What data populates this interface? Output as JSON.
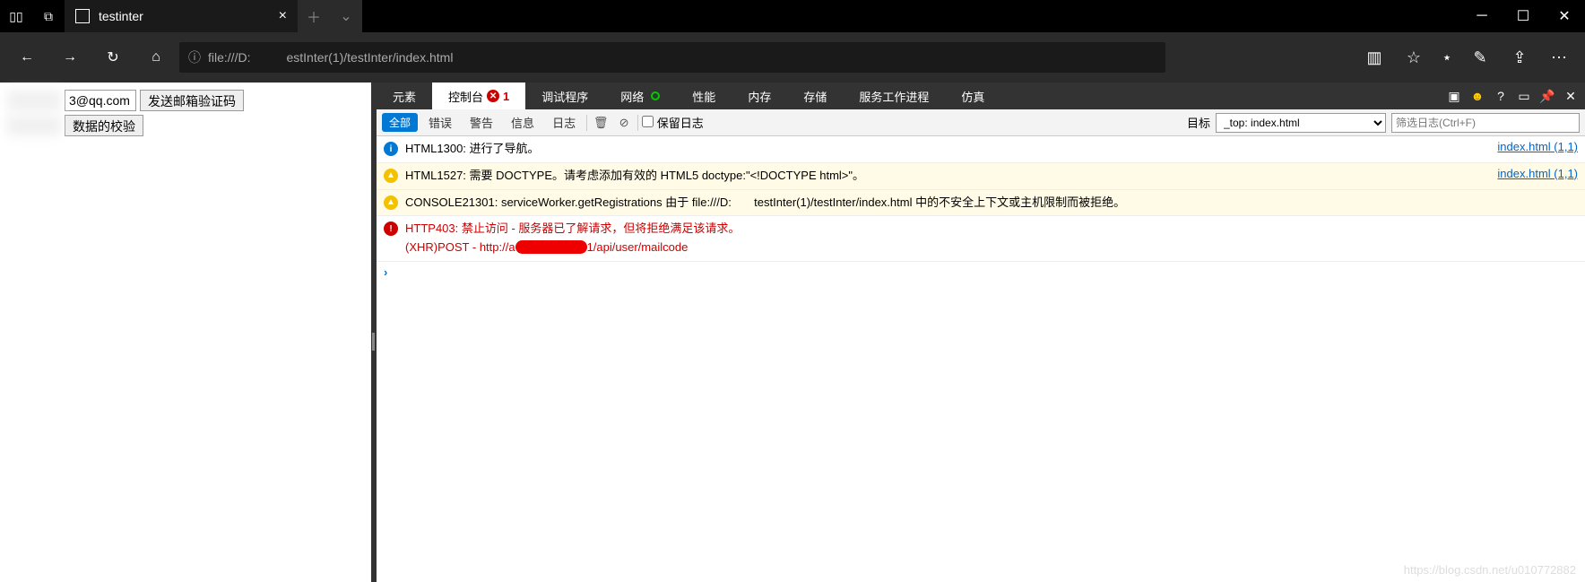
{
  "window": {
    "tab_title": "testinter",
    "url_left": "file:///D:",
    "url_right": "estInter(1)/testInter/index.html"
  },
  "page": {
    "email_value": "3@qq.com",
    "send_btn": "发送邮箱验证码",
    "check_btn": "数据的校验"
  },
  "devtools": {
    "tabs": {
      "elements": "元素",
      "console": "控制台",
      "console_err_count": "1",
      "debugger": "调试程序",
      "network": "网络",
      "performance": "性能",
      "memory": "内存",
      "storage": "存储",
      "serviceworker": "服务工作进程",
      "emulation": "仿真"
    },
    "filter": {
      "all": "全部",
      "errors": "错误",
      "warnings": "警告",
      "info": "信息",
      "logs": "日志",
      "preserve": "保留日志",
      "target_label": "目标",
      "target_value": "_top: index.html",
      "filter_placeholder": "筛选日志(Ctrl+F)"
    },
    "messages": {
      "m1": {
        "text": "HTML1300: 进行了导航。",
        "src": "index.html (1,1)"
      },
      "m2": {
        "text": "HTML1527: 需要 DOCTYPE。请考虑添加有效的 HTML5 doctype:\"<!DOCTYPE html>\"。",
        "src": "index.html (1,1)"
      },
      "m3": {
        "text": "CONSOLE21301: serviceWorker.getRegistrations 由于 file:///D:       testInter(1)/testInter/index.html 中的不安全上下文或主机限制而被拒绝。"
      },
      "m4": {
        "line1": "HTTP403: 禁止访问 - 服务器已了解请求，但将拒绝满足该请求。",
        "line2a": "(XHR)POST - http://a",
        "line2b": "1/api/user/mailcode"
      }
    }
  },
  "watermark": "https://blog.csdn.net/u010772882"
}
